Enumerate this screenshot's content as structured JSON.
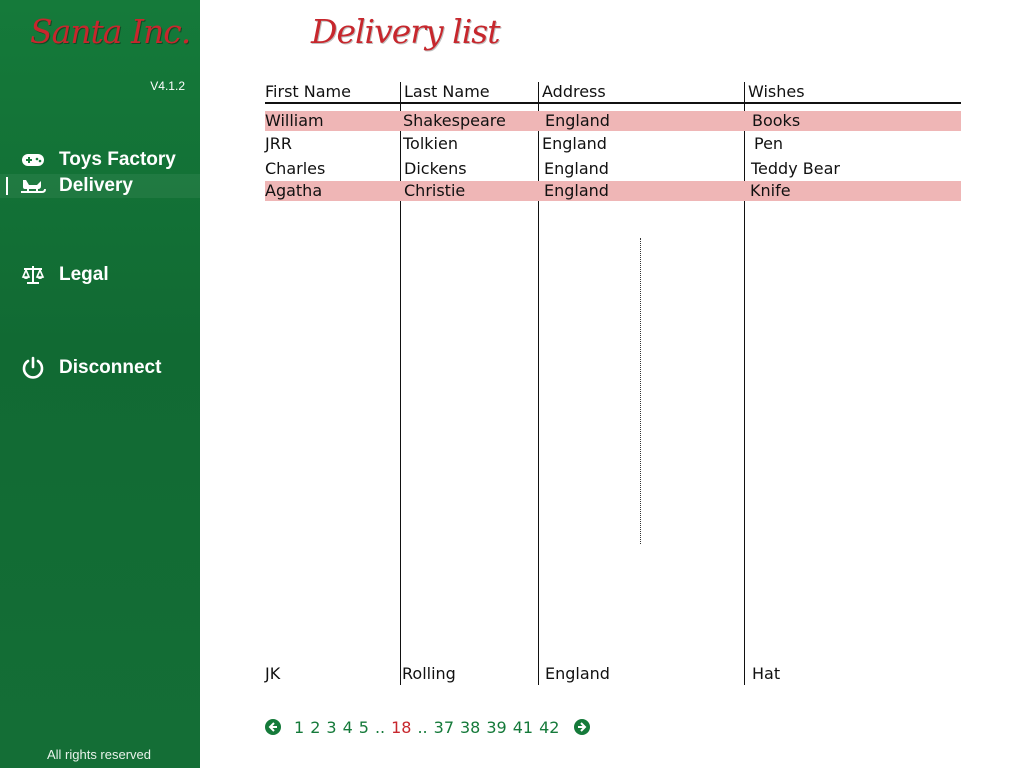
{
  "sidebar": {
    "logo": "Santa Inc.",
    "version": "V4.1.2",
    "items": [
      {
        "label": "Toys Factory",
        "icon": "gamepad-icon"
      },
      {
        "label": "Delivery",
        "icon": "sleigh-icon",
        "active": true
      },
      {
        "label": "Legal",
        "icon": "scale-icon"
      },
      {
        "label": "Disconnect",
        "icon": "power-icon"
      }
    ],
    "footer": "All rights reserved"
  },
  "main": {
    "title": "Delivery list",
    "columns": [
      "First Name",
      "Last Name",
      "Address",
      "Wishes"
    ],
    "rows": [
      {
        "first": "William",
        "last": "Shakespeare",
        "address": "England",
        "wishes": "Books",
        "highlight": true
      },
      {
        "first": "JRR",
        "last": "Tolkien",
        "address": "England",
        "wishes": "Pen",
        "highlight": false
      },
      {
        "first": "Charles",
        "last": "Dickens",
        "address": "England",
        "wishes": "Teddy Bear",
        "highlight": false
      },
      {
        "first": "Agatha",
        "last": "Christie",
        "address": "England",
        "wishes": "Knife",
        "highlight": true
      },
      {
        "first": "JK",
        "last": "Rolling",
        "address": "England",
        "wishes": "Hat",
        "highlight": false
      }
    ]
  },
  "pagination": {
    "pages_before": [
      "1",
      "2",
      "3",
      "4",
      "5"
    ],
    "separator": "..",
    "current": "18",
    "pages_after": [
      "37",
      "38",
      "39",
      "41",
      "42"
    ]
  },
  "colors": {
    "sidebar": "#157a3a",
    "accent": "#c7272d",
    "row_highlight": "#efb6b6"
  }
}
